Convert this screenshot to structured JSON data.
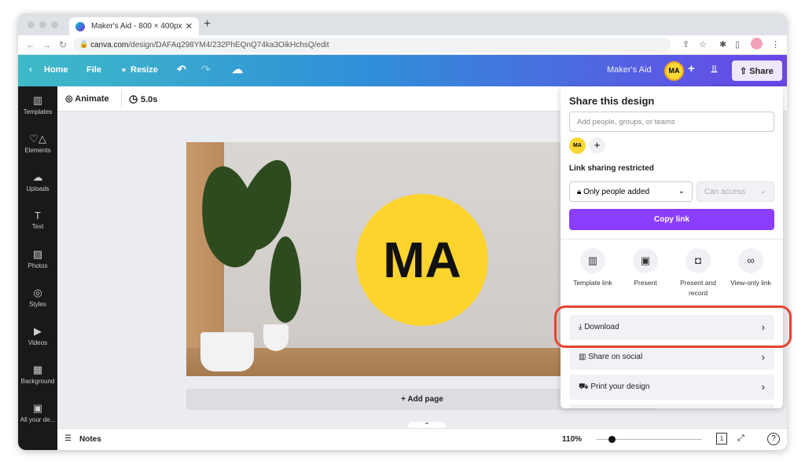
{
  "browser": {
    "tab_title": "Maker's Aid - 800 × 400px",
    "url_domain": "canva.com",
    "url_path": "/design/DAFAq298YM4/232PhEQnQ74ka3OikHchsQ/edit"
  },
  "header": {
    "home": "Home",
    "file": "File",
    "resize": "Resize",
    "team": "Maker's Aid",
    "avatar": "MA",
    "share": "Share",
    "accent": "#8b3dff"
  },
  "sidebar": {
    "items": [
      {
        "label": "Templates",
        "icon": "▥"
      },
      {
        "label": "Elements",
        "icon": "♡△"
      },
      {
        "label": "Uploads",
        "icon": "☁"
      },
      {
        "label": "Text",
        "icon": "T"
      },
      {
        "label": "Photos",
        "icon": "▨"
      },
      {
        "label": "Styles",
        "icon": "◎"
      },
      {
        "label": "Videos",
        "icon": "▶"
      },
      {
        "label": "Background",
        "icon": "▦"
      },
      {
        "label": "All your de...",
        "icon": "▣"
      }
    ]
  },
  "toolbar": {
    "animate": "Animate",
    "duration": "5.0s"
  },
  "canvas": {
    "logo_text": "MA",
    "add_page": "+ Add page"
  },
  "bottom": {
    "notes": "Notes",
    "zoom": "110%",
    "zoom_fraction": 0.15,
    "page": "1"
  },
  "share_panel": {
    "title": "Share this design",
    "placeholder": "Add people, groups, or teams",
    "member": "MA",
    "link_heading": "Link sharing restricted",
    "access_scope": "Only people added",
    "access_level": "Can access",
    "copy_link": "Copy link",
    "options": [
      {
        "label": "Template link",
        "icon": "▥"
      },
      {
        "label": "Present",
        "icon": "▣"
      },
      {
        "label": "Present and record",
        "icon": "◘"
      },
      {
        "label": "View-only link",
        "icon": "∞"
      }
    ],
    "actions": [
      {
        "label": "Download",
        "icon": "⤓"
      },
      {
        "label": "Share on social",
        "icon": "▥"
      },
      {
        "label": "Print your design",
        "icon": "⛟"
      }
    ]
  }
}
